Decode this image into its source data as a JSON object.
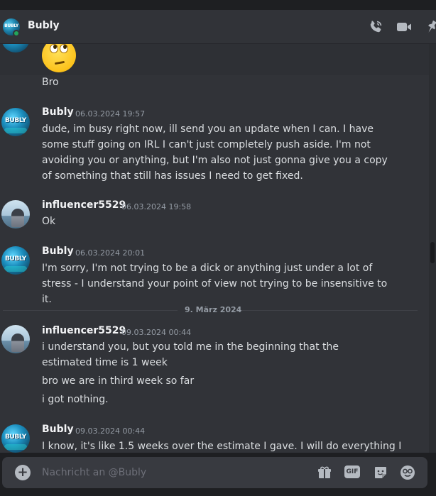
{
  "header": {
    "title": "Bubly",
    "avatar_text": "BUBLY",
    "icons": [
      "phone-call-icon",
      "video-camera-icon",
      "pin-icon"
    ]
  },
  "messages": {
    "m0": {
      "emoji": "face-with-rolling-eyes",
      "text": "Bro"
    },
    "m1": {
      "author": "Bubly",
      "avatar_text": "BUBLY",
      "timestamp": "06.03.2024 19:57",
      "text": "dude, im busy right now, ill send you an update when I can. I have some stuff going on IRL I can't just completely push aside. I'm not avoiding you or anything, but I'm also not just gonna give you a copy of something that still has issues I need to get fixed."
    },
    "m2": {
      "author": "influencer5529",
      "timestamp": "06.03.2024 19:58",
      "text": "Ok"
    },
    "m3": {
      "author": "Bubly",
      "avatar_text": "BUBLY",
      "timestamp": "06.03.2024 20:01",
      "text": "I'm sorry, I'm not trying to be a dick or anything just under a lot of stress - I understand your point of view not trying to be insensitive to it."
    },
    "date_divider": "9. März 2024",
    "m4": {
      "author": "influencer5529",
      "timestamp": "09.03.2024 00:44",
      "text": "i understand you, but you told me in the beginning that the estimated time is 1 week",
      "followups": [
        "bro we are in third week so far",
        "i got nothing."
      ]
    },
    "m5": {
      "author": "Bubly",
      "avatar_text": "BUBLY",
      "timestamp": "09.03.2024 00:44",
      "text": "I know, it's like 1.5 weeks over the estimate I gave. I will do everything I"
    }
  },
  "composer": {
    "placeholder": "Nachricht an @Bubly",
    "gif_label": "GIF",
    "icons": [
      "gift-icon",
      "gif-icon",
      "sticker-icon",
      "emoji-icon"
    ]
  },
  "colors": {
    "background": "#313338",
    "header_bg": "#313338",
    "composer_bg": "#383a40",
    "username": "#f2f3f5",
    "timestamp": "#949ba4",
    "message_text": "#dbdee1",
    "online_status": "#23a55a"
  }
}
